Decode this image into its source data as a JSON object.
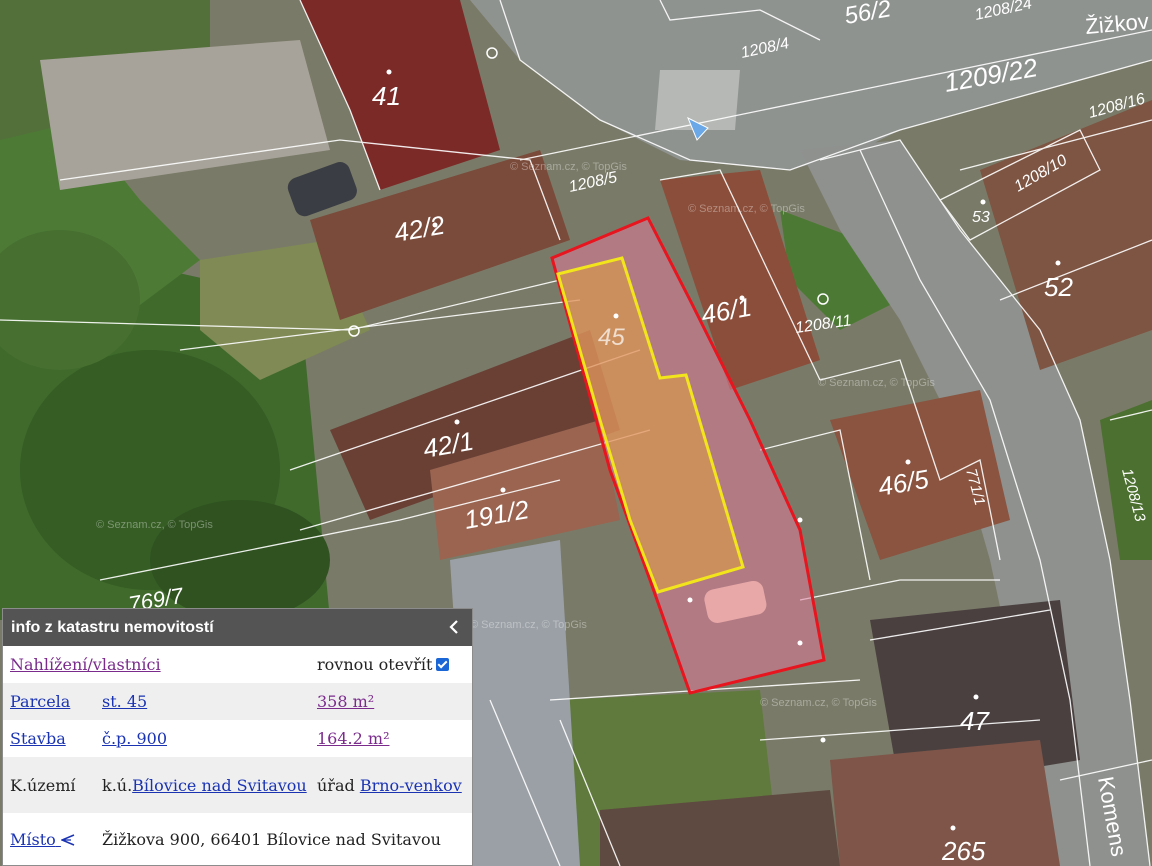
{
  "map": {
    "parcel_labels": [
      "41",
      "42/2",
      "45",
      "46/1",
      "42/1",
      "191/2",
      "46/5",
      "47",
      "52",
      "53",
      "56/2",
      "1208/4",
      "1208/5",
      "1208/11",
      "1208/10",
      "1208/16",
      "1208/13",
      "1209/22",
      "1208/24",
      "771/1",
      "769/7",
      "265"
    ],
    "street_labels": [
      "Žižkov",
      "Komens"
    ],
    "watermark": "© Seznam.cz, © TopGis",
    "colors": {
      "parcel_outline": "#e8141e",
      "building_outline": "#f2e51c",
      "parcel_fill": "#e07c9a",
      "building_fill": "#e0a040"
    }
  },
  "panel": {
    "title": "info z katastru nemovitostí",
    "collapse_icon": "chevron-left-icon",
    "rows": {
      "owners_link": "Nahlížení/vlastníci",
      "open_directly": "rovnou otevřít",
      "open_directly_checked": true,
      "parcel_label": "Parcela",
      "parcel_number": "st. 45",
      "parcel_area": "358 m²",
      "building_label": "Stavba",
      "building_number": "č.p. 900",
      "building_area": "164.2 m²",
      "cadastre_label": "K.území",
      "cadastre_prefix": "k.ú.",
      "cadastre_name": "Bílovice nad Svitavou",
      "office_label": "úřad",
      "office_name": "Brno-venkov",
      "place_label": "Místo",
      "place_icon": "share-icon",
      "address": "Žižkova 900, 66401 Bílovice nad Svitavou"
    }
  }
}
